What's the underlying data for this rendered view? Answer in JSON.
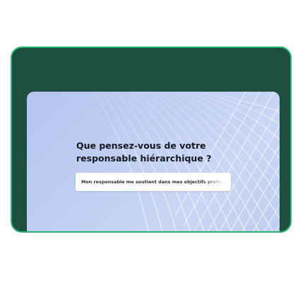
{
  "survey": {
    "question": "Que pensez-vous de votre responsable hiérarchique ?",
    "answer_text": "Mon responsable me soutient dans mes objectifs profe..."
  },
  "colors": {
    "frame_background": "#1e4e3f",
    "frame_border": "#27b36f",
    "panel_background": "#c2d0f3",
    "question_text": "#15181f"
  }
}
